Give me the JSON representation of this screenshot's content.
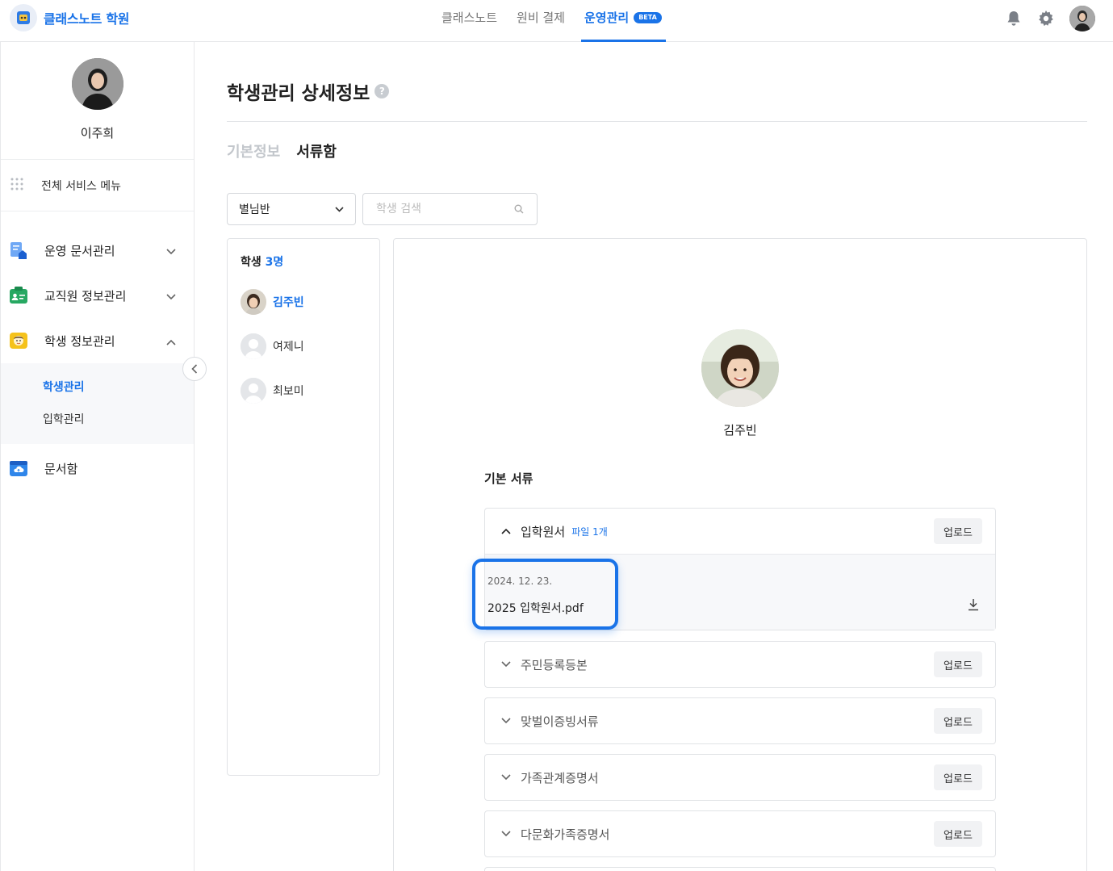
{
  "header": {
    "brand_name": "클래스노트 학원",
    "nav": [
      {
        "label": "클래스노트"
      },
      {
        "label": "원비 결제"
      },
      {
        "label": "운영관리",
        "badge": "BETA"
      }
    ],
    "icons": [
      "bell-icon",
      "gear-icon",
      "user-avatar"
    ]
  },
  "sidebar": {
    "user_name": "이주희",
    "all_menu_label": "전체 서비스 메뉴",
    "items": [
      {
        "label": "운영 문서관리",
        "icon": "document-house-icon",
        "expanded": false
      },
      {
        "label": "교직원 정보관리",
        "icon": "staff-card-icon",
        "expanded": false
      },
      {
        "label": "학생 정보관리",
        "icon": "student-face-icon",
        "expanded": true
      },
      {
        "label": "문서함",
        "icon": "cloud-folder-icon"
      }
    ],
    "subitems": [
      {
        "label": "학생관리",
        "active": true
      },
      {
        "label": "입학관리",
        "active": false
      }
    ]
  },
  "main": {
    "title": "학생관리 상세정보",
    "tabs": [
      {
        "label": "기본정보",
        "active": false
      },
      {
        "label": "서류함",
        "active": true
      }
    ],
    "class_select": "별님반",
    "search_placeholder": "학생 검색",
    "student_list": {
      "label": "학생",
      "count": "3명",
      "students": [
        {
          "name": "김주빈",
          "active": true
        },
        {
          "name": "여제니",
          "active": false
        },
        {
          "name": "최보미",
          "active": false
        }
      ]
    },
    "detail": {
      "student_name": "김주빈",
      "section_title": "기본 서류",
      "upload_label": "업로드",
      "documents": [
        {
          "name": "입학원서",
          "file_count": "파일 1개",
          "open": true
        },
        {
          "name": "주민등록등본",
          "open": false
        },
        {
          "name": "맞벌이증빙서류",
          "open": false
        },
        {
          "name": "가족관계증명서",
          "open": false
        },
        {
          "name": "다문화가족증명서",
          "open": false
        }
      ],
      "file": {
        "date": "2024. 12. 23.",
        "name": "2025 입학원서.pdf"
      }
    }
  },
  "colors": {
    "accent": "#1a73e8"
  }
}
